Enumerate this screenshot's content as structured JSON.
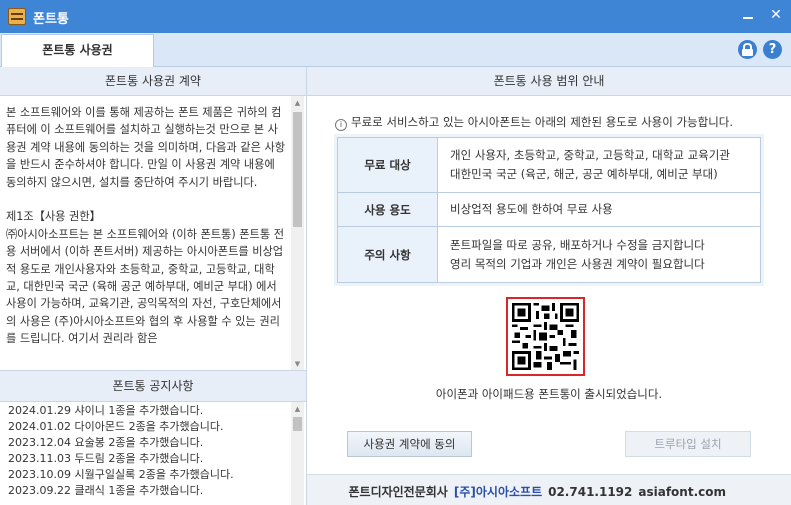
{
  "window": {
    "title": "폰트통",
    "minimize_glyph": "",
    "close_glyph": "✕"
  },
  "tabs": [
    {
      "label": "폰트통 사용권",
      "active": true
    }
  ],
  "header_icons": [
    "lock-icon",
    "help-icon"
  ],
  "help_glyph": "?",
  "left": {
    "license_header": "폰트통 사용권 계약",
    "license_text": "본 소프트웨어와 이를 통해 제공하는 폰트 제품은 귀하의 컴퓨터에 이 소프트웨어를 설치하고 실행하는것 만으로 본 사용권 계약 내용에 동의하는 것을 의미하며, 다음과 같은 사항을 반드시 준수하셔야 합니다. 만일 이 사용권 계약 내용에 동의하지 않으시면, 설치를 중단하여 주시기 바랍니다.\n\n제1조【사용 권한】\n㈜아시아소프트는 본 소프트웨어와 (이하 폰트통) 폰트통 전용 서버에서 (이하 폰트서버) 제공하는 아시아폰트를 비상업적 용도로 개인사용자와 초등학교, 중학교, 고등학교, 대학교, 대한민국 국군 (육해 공군 예하부대, 예비군 부대) 에서 사용이 가능하며, 교육기관, 공익목적의 자선, 구호단체에서의 사용은 (주)아시아소프트와 협의 후 사용할 수 있는 권리를 드립니다. 여기서 권리라 함은",
    "notice_header": "폰트통 공지사항",
    "notices": [
      "2024.01.29 샤이니 1종을 추가했습니다.",
      "2024.01.02 다이아몬드 2종을 추가했습니다.",
      "2023.12.04 요술봉 2종을 추가했습니다.",
      "2023.11.03 두드림 2종을 추가했습니다.",
      "2023.10.09 시월구일실록 2종을 추가했습니다.",
      "2023.09.22 클래식 1종을 추가했습니다."
    ]
  },
  "right": {
    "header": "폰트통 사용 범위 안내",
    "info_glyph": "i",
    "info": "무료로 서비스하고 있는 아시아폰트는 아래의 제한된 용도로 사용이 가능합니다.",
    "table": [
      {
        "key": "무료 대상",
        "lines": [
          "개인 사용자, 초등학교, 중학교, 고등학교, 대학교 교육기관",
          "대한민국 국군 (육군, 해군, 공군 예하부대, 예비군 부대)"
        ]
      },
      {
        "key": "사용 용도",
        "lines": [
          "비상업적 용도에 한하여 무료 사용"
        ]
      },
      {
        "key": "주의 사항",
        "lines": [
          "폰트파일을 따로 공유, 배포하거나 수정을 금지합니다",
          "영리 목적의 기업과 개인은 사용권 계약이 필요합니다"
        ]
      }
    ],
    "release_note": "아이폰과 아이패드용 폰트통이 출시되었습니다.",
    "agree_button": "사용권 계약에 동의",
    "install_button": "트루타입 설치"
  },
  "footer": {
    "company": "폰트디자인전문회사",
    "brand": "[주]아시아소프트",
    "phone": "02.741.1192",
    "site": "asiafont.com"
  },
  "colors": {
    "titlebar": "#3e85d6",
    "brand": "#2a4fa8",
    "qr_border": "#d9262b"
  }
}
